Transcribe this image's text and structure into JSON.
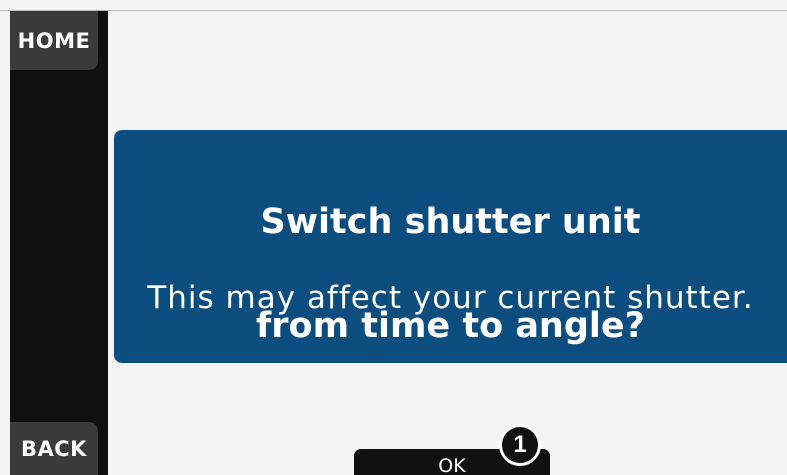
{
  "nav": {
    "home_label": "HOME",
    "back_label": "BACK"
  },
  "dialog": {
    "title_line1": "Switch shutter unit",
    "title_line2": "from time to angle?",
    "message": "This may affect your current shutter."
  },
  "actions": {
    "ok_label": "OK"
  },
  "annotation": {
    "marker_number": "1"
  },
  "colors": {
    "dialog_background": "#0b4d7e",
    "sidebar": "#101010",
    "soft_button": "#3a3a3a",
    "screen_background": "#f3f3f3"
  }
}
